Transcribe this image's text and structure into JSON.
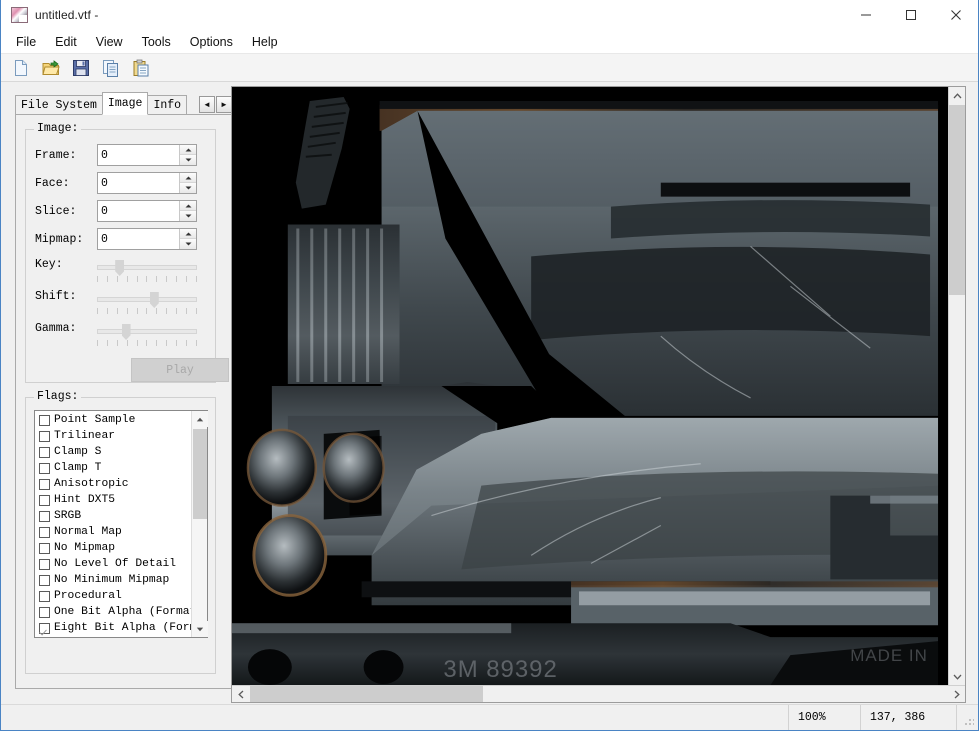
{
  "window": {
    "title": "untitled.vtf -",
    "icon": "app-icon",
    "controls": {
      "minimize": "minimize-icon",
      "maximize": "maximize-icon",
      "close": "close-icon"
    }
  },
  "menubar": {
    "items": [
      {
        "label": "File"
      },
      {
        "label": "Edit"
      },
      {
        "label": "View"
      },
      {
        "label": "Tools"
      },
      {
        "label": "Options"
      },
      {
        "label": "Help"
      }
    ]
  },
  "toolbar": {
    "buttons": [
      {
        "name": "new-file-button",
        "icon": "new-file-icon"
      },
      {
        "name": "open-file-button",
        "icon": "open-folder-icon"
      },
      {
        "name": "save-file-button",
        "icon": "save-floppy-icon"
      },
      {
        "name": "copy-button",
        "icon": "copy-icon"
      },
      {
        "name": "paste-button",
        "icon": "paste-clipboard-icon"
      }
    ]
  },
  "tabs": {
    "items": [
      {
        "label": "File System",
        "active": false
      },
      {
        "label": "Image",
        "active": true
      },
      {
        "label": "Info",
        "active": false
      }
    ],
    "scroll_left": "◄",
    "scroll_right": "►"
  },
  "image_group": {
    "title": "Image:",
    "fields": [
      {
        "label": "Frame:",
        "value": "0"
      },
      {
        "label": "Face:",
        "value": "0"
      },
      {
        "label": "Slice:",
        "value": "0"
      },
      {
        "label": "Mipmap:",
        "value": "0"
      }
    ],
    "sliders": [
      {
        "label": "Key:",
        "percent": 20
      },
      {
        "label": "Shift:",
        "percent": 58
      },
      {
        "label": "Gamma:",
        "percent": 27
      }
    ],
    "play_button": {
      "label": "Play",
      "enabled": false
    }
  },
  "flags_group": {
    "title": "Flags:",
    "items": [
      {
        "label": "Point Sample",
        "checked": false
      },
      {
        "label": "Trilinear",
        "checked": false
      },
      {
        "label": "Clamp S",
        "checked": false
      },
      {
        "label": "Clamp T",
        "checked": false
      },
      {
        "label": "Anisotropic",
        "checked": false
      },
      {
        "label": "Hint DXT5",
        "checked": false
      },
      {
        "label": "SRGB",
        "checked": false
      },
      {
        "label": "Normal Map",
        "checked": false
      },
      {
        "label": "No Mipmap",
        "checked": false
      },
      {
        "label": "No Level Of Detail",
        "checked": false
      },
      {
        "label": "No Minimum Mipmap",
        "checked": false
      },
      {
        "label": "Procedural",
        "checked": false
      },
      {
        "label": "One Bit Alpha (Format",
        "checked": false
      },
      {
        "label": "Eight Bit Alpha (Form",
        "checked": true
      }
    ]
  },
  "image_view": {
    "texture_text_1": "3M  89392",
    "texture_text_2": "MADE IN",
    "background_color": "#000000",
    "vscrollbar": {
      "up": "∧",
      "down": "∨"
    },
    "hscrollbar": {
      "left": "‹",
      "right": "›"
    }
  },
  "statusbar": {
    "message": "",
    "zoom": "100%",
    "coordinates": "137, 386"
  }
}
